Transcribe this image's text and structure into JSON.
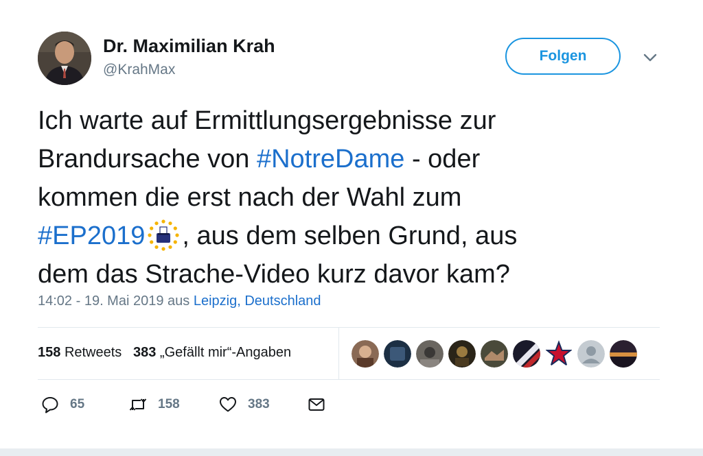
{
  "author": {
    "name": "Dr. Maximilian Krah",
    "handle": "@KrahMax"
  },
  "follow_label": "Folgen",
  "tweet": {
    "line1": "Ich warte auf Ermittlungsergebnisse zur",
    "line2_a": "Brandursache von ",
    "line2_tag": "#NotreDame",
    "line2_b": " - oder",
    "line3": "kommen die erst nach der Wahl zum",
    "line4_tag": "#EP2019",
    "line4_b": ", aus dem selben Grund, aus",
    "line5": "dem das Strache-Video kurz davor kam?"
  },
  "timestamp": {
    "time_date": "14:02 - 19. Mai 2019 aus ",
    "location": "Leipzig, Deutschland"
  },
  "stats": {
    "retweets_count": "158",
    "retweets_label": "Retweets",
    "likes_count": "383",
    "likes_label": "„Gefällt mir“-Angaben"
  },
  "actions": {
    "reply_count": "65",
    "retweet_count": "158",
    "like_count": "383"
  },
  "colors": {
    "link": "#1b6fcc",
    "follow_accent": "#1b95e0",
    "secondary_text": "#657786"
  }
}
